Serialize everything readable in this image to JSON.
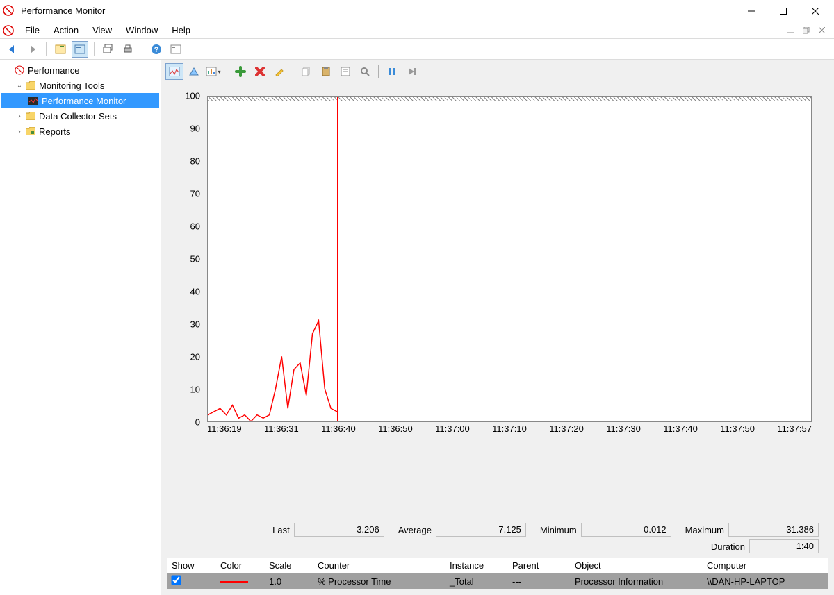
{
  "window": {
    "title": "Performance Monitor"
  },
  "menubar": {
    "items": [
      "File",
      "Action",
      "View",
      "Window",
      "Help"
    ]
  },
  "tree": {
    "root": "Performance",
    "monitoring_tools": "Monitoring Tools",
    "performance_monitor": "Performance Monitor",
    "data_collector_sets": "Data Collector Sets",
    "reports": "Reports"
  },
  "stats": {
    "last_label": "Last",
    "last_value": "3.206",
    "average_label": "Average",
    "average_value": "7.125",
    "minimum_label": "Minimum",
    "minimum_value": "0.012",
    "maximum_label": "Maximum",
    "maximum_value": "31.386",
    "duration_label": "Duration",
    "duration_value": "1:40"
  },
  "legend": {
    "headers": {
      "show": "Show",
      "color": "Color",
      "scale": "Scale",
      "counter": "Counter",
      "instance": "Instance",
      "parent": "Parent",
      "object": "Object",
      "computer": "Computer"
    },
    "row": {
      "show": true,
      "color": "#ff0000",
      "scale": "1.0",
      "counter": "% Processor Time",
      "instance": "_Total",
      "parent": "---",
      "object": "Processor Information",
      "computer": "\\\\DAN-HP-LAPTOP"
    }
  },
  "chart_data": {
    "type": "line",
    "title": "",
    "xlabel": "",
    "ylabel": "",
    "ylim": [
      0,
      100
    ],
    "y_ticks": [
      0,
      10,
      20,
      30,
      40,
      50,
      60,
      70,
      80,
      90,
      100
    ],
    "x_ticks": [
      "11:36:19",
      "11:36:31",
      "11:36:40",
      "11:36:50",
      "11:37:00",
      "11:37:10",
      "11:37:20",
      "11:37:30",
      "11:37:40",
      "11:37:50",
      "11:37:57"
    ],
    "cursor_time": "11:36:40",
    "series": [
      {
        "name": "% Processor Time",
        "color": "#ff0000",
        "x": [
          0,
          1,
          2,
          3,
          4,
          5,
          6,
          7,
          8,
          9,
          10,
          11,
          12,
          13,
          14,
          15,
          16,
          17,
          18,
          19,
          20,
          21
        ],
        "values": [
          2,
          3,
          4,
          2,
          5,
          1,
          2,
          0,
          2,
          1,
          2,
          10,
          20,
          4,
          16,
          18,
          8,
          27,
          31,
          10,
          4,
          3
        ]
      }
    ],
    "x_span_seconds": 98
  }
}
